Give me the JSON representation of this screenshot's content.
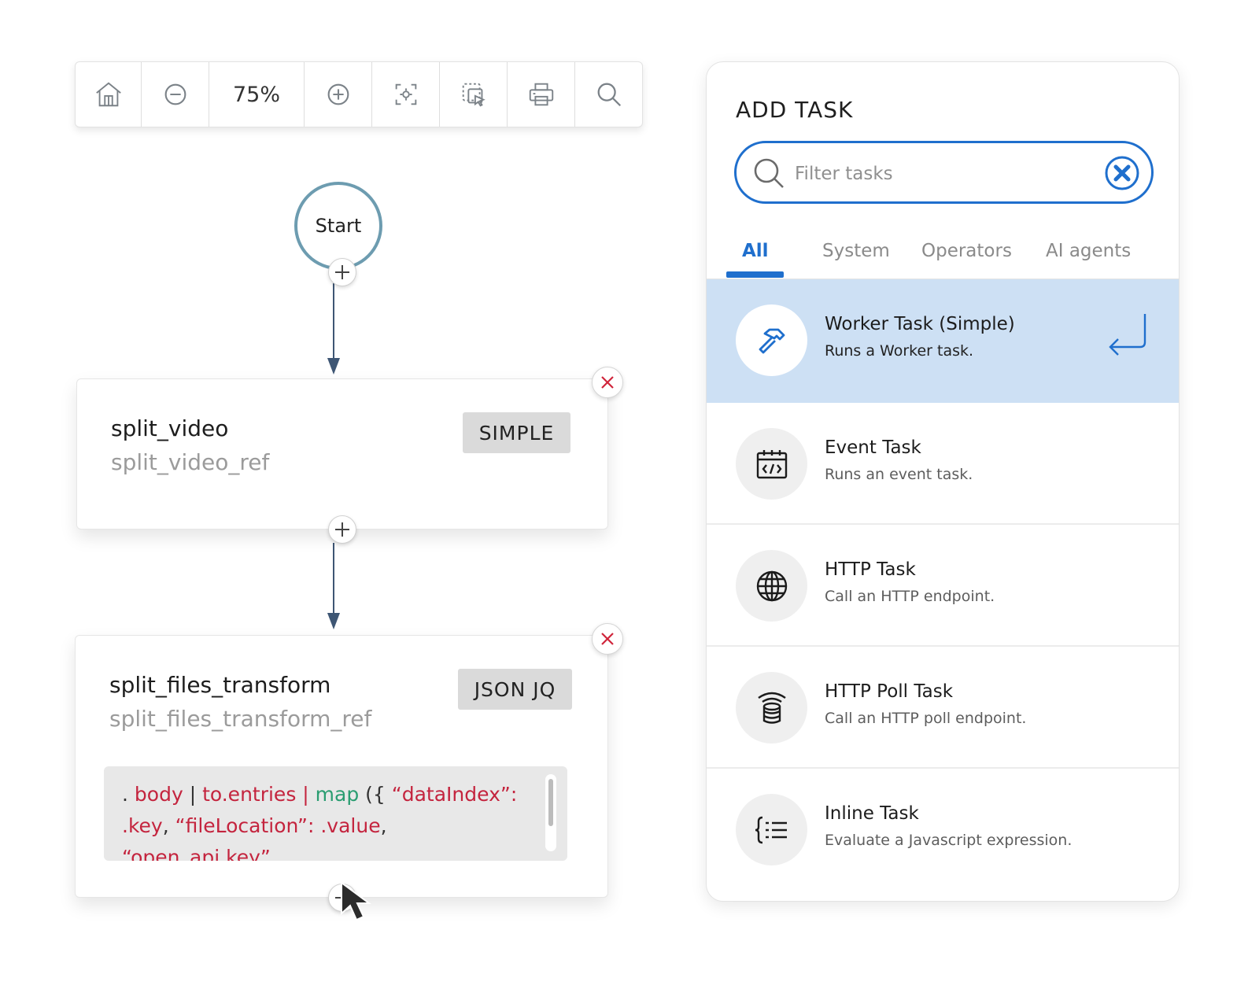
{
  "toolbar": {
    "zoom_label": "75%",
    "buttons": [
      "home-icon",
      "zoom-out-icon",
      "zoom-in-icon",
      "fit-to-screen-icon",
      "select-area-icon",
      "print-icon",
      "search-icon"
    ]
  },
  "workflow": {
    "start_label": "Start",
    "tasks": [
      {
        "name": "split_video",
        "ref": "split_video_ref",
        "type": "SIMPLE"
      },
      {
        "name": "split_files_transform",
        "ref": "split_files_transform_ref",
        "type": "JSON JQ",
        "expression": {
          "line1": [
            ". ",
            "body",
            " | ",
            "to.entries",
            " | ",
            "map",
            " ({ ",
            "“dataIndex”:"
          ],
          "line2": [
            ".key",
            ",  ",
            "“fileLocation”: .value",
            ","
          ],
          "line3": [
            "“open_api.key”"
          ]
        }
      }
    ]
  },
  "add_task_panel": {
    "title": "ADD TASK",
    "filter_placeholder": "Filter tasks",
    "filter_value": "",
    "tabs": [
      {
        "label": "All",
        "active": true
      },
      {
        "label": "System",
        "active": false
      },
      {
        "label": "Operators",
        "active": false
      },
      {
        "label": "AI agents",
        "active": false
      }
    ],
    "tasks": [
      {
        "title": "Worker Task (Simple)",
        "description": "Runs a Worker task.",
        "icon": "hammer-icon",
        "selected": true
      },
      {
        "title": "Event Task",
        "description": "Runs an event task.",
        "icon": "calendar-code-icon",
        "selected": false
      },
      {
        "title": "HTTP Task",
        "description": "Call an HTTP endpoint.",
        "icon": "globe-icon",
        "selected": false
      },
      {
        "title": "HTTP Poll Task",
        "description": "Call an HTTP poll endpoint.",
        "icon": "database-poll-icon",
        "selected": false
      },
      {
        "title": "Inline Task",
        "description": "Evaluate a Javascript expression.",
        "icon": "code-braces-icon",
        "selected": false
      }
    ]
  },
  "colors": {
    "accent": "#1f6fcd",
    "selected_row": "#cde0f4",
    "start_ring": "#6d9cb0",
    "delete_x": "#d0243a",
    "code_red": "#c4243e",
    "code_green": "#2a9d71",
    "type_badge": "#dadada"
  }
}
